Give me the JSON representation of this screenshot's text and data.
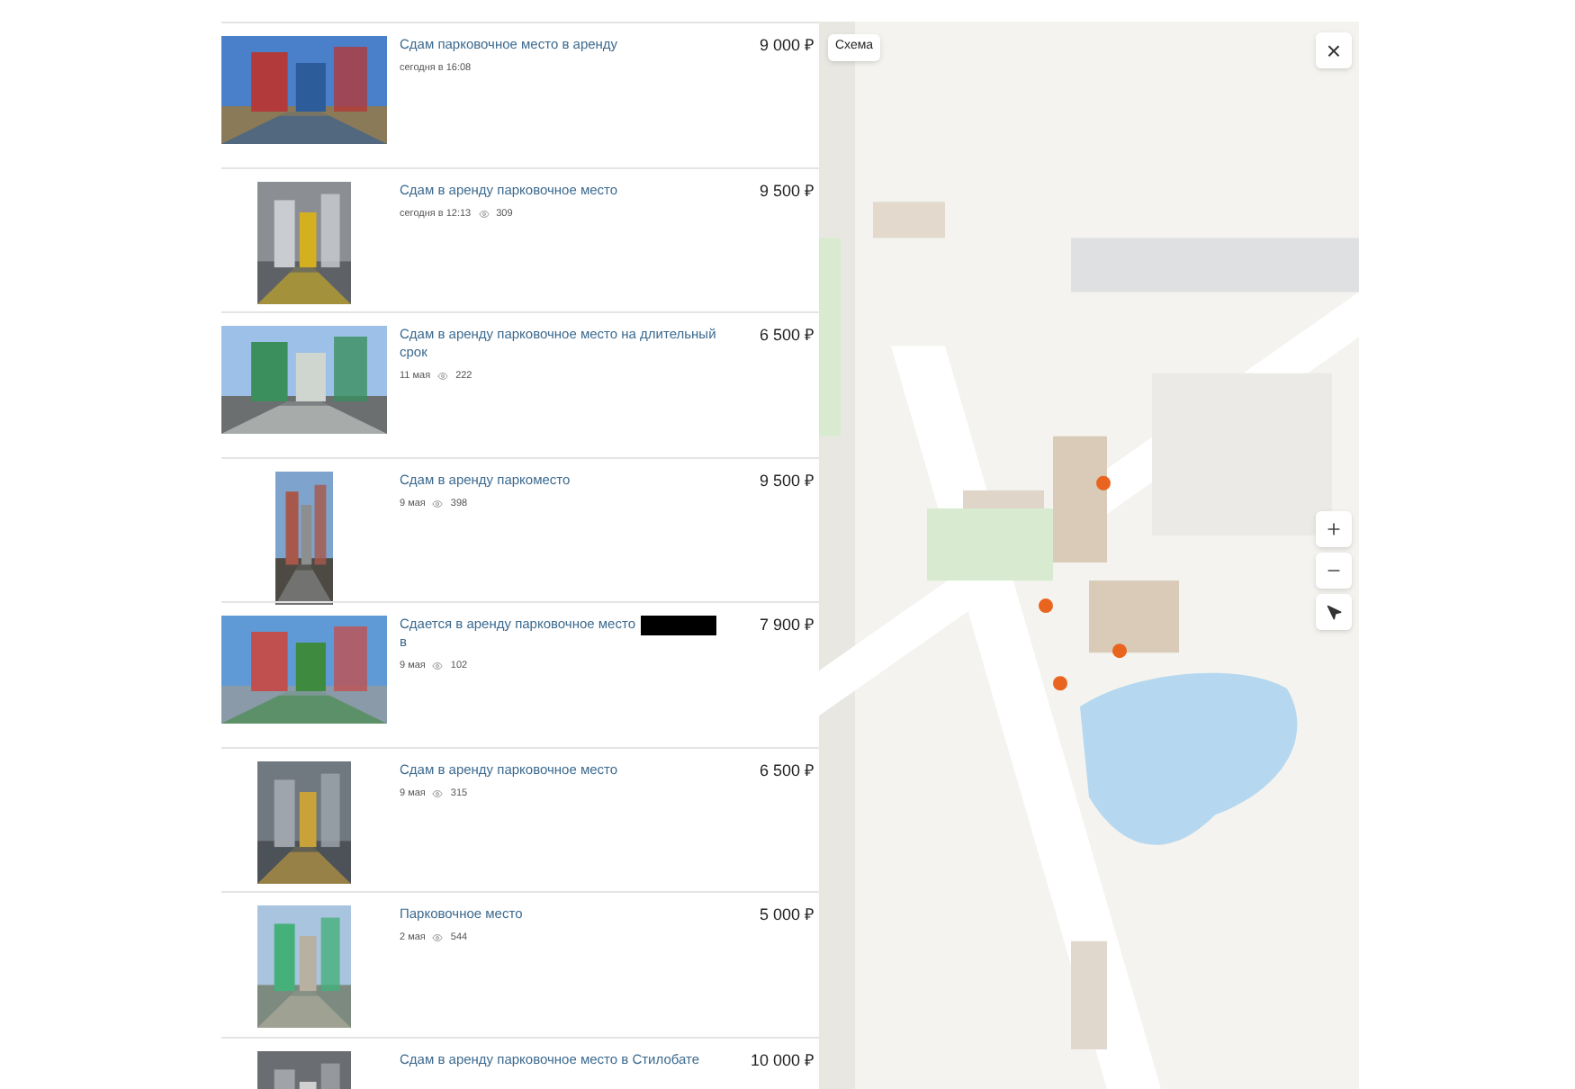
{
  "listings": [
    {
      "title": "Сдам парковочное место в аренду",
      "price": "9 000 ₽",
      "date": "сегодня в 16:08",
      "redacted": false
    },
    {
      "title": "Сдам в аренду парковочное место",
      "price": "9 500 ₽",
      "date": "сегодня в 12:13",
      "views": "309",
      "redacted": false
    },
    {
      "title": "Сдам в аренду парковочное место на длительный срок",
      "price": "6 500 ₽",
      "date": "11 мая",
      "views": "222",
      "redacted": false
    },
    {
      "title": "Сдам в аренду паркоместо",
      "price": "9 500 ₽",
      "date": "9 мая",
      "views": "398",
      "redacted": false
    },
    {
      "title": "Сдается в аренду парковочное место в",
      "price": "7 900 ₽",
      "date": "9 мая",
      "views": "102",
      "redacted": true
    },
    {
      "title": "Сдам в аренду парковочное место",
      "price": "6 500 ₽",
      "date": "9 мая",
      "views": "315",
      "redacted": false
    },
    {
      "title": "Парковочное место",
      "price": "5 000 ₽",
      "date": "2 мая",
      "views": "544",
      "redacted": false
    },
    {
      "title": "Сдам в аренду парковочное место в Стилобате",
      "price": "10 000 ₽",
      "redacted": false
    }
  ],
  "map": {
    "layer_button": "Схема",
    "close": "×"
  }
}
